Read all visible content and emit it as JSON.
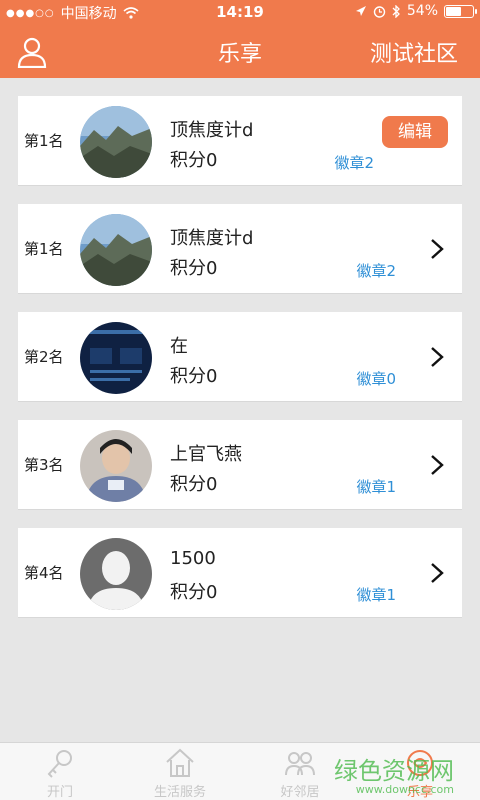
{
  "status_bar": {
    "carrier": "中国移动",
    "time": "14:19",
    "battery": "54%"
  },
  "navbar": {
    "title": "乐享",
    "right_label": "测试社区"
  },
  "list": [
    {
      "rank": "第1名",
      "name": "顶焦度计d",
      "score": "积分0",
      "badge": "徽章2",
      "action": "编辑",
      "avatar": "landscape"
    },
    {
      "rank": "第1名",
      "name": "顶焦度计d",
      "score": "积分0",
      "badge": "徽章2",
      "avatar": "landscape"
    },
    {
      "rank": "第2名",
      "name": "在",
      "score": "积分0",
      "badge": "徽章0",
      "avatar": "screen"
    },
    {
      "rank": "第3名",
      "name": "上官飞燕",
      "score": "积分0",
      "badge": "徽章1",
      "avatar": "person"
    },
    {
      "rank": "第4名",
      "name": "1500",
      "score": "积分0",
      "badge": "徽章1",
      "avatar": "default"
    }
  ],
  "tabbar": {
    "tabs": [
      {
        "label": "开门",
        "icon": "key-icon"
      },
      {
        "label": "生活服务",
        "icon": "home-icon"
      },
      {
        "label": "好邻居",
        "icon": "people-icon"
      },
      {
        "label": "乐享",
        "icon": "share-icon"
      }
    ]
  },
  "watermark": {
    "text": "绿色资源网",
    "url": "www.downcc.com"
  },
  "colors": {
    "accent": "#f07a4c",
    "badge": "#2f8fd6",
    "background": "#e6e6e6"
  }
}
